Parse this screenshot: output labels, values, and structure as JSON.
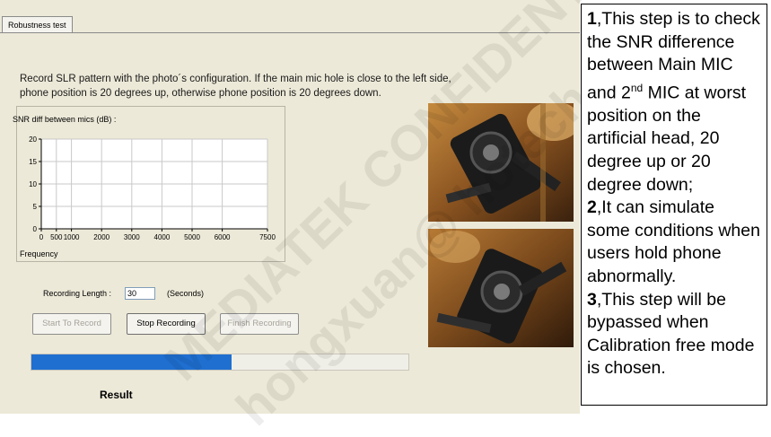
{
  "tab": {
    "label": "Robustness test"
  },
  "instructions": {
    "line1": "Record SLR pattern with the photo´s configuration. If the main mic hole is close to the left side,",
    "line2": "phone position is 20 degrees up, otherwise phone position is 20 degrees down."
  },
  "chart": {
    "group_title": "SNR diff between mics (dB) :",
    "xlabel": "Frequency"
  },
  "chart_data": {
    "type": "line",
    "title": "SNR diff between mics (dB) :",
    "xlabel": "Frequency",
    "ylabel": "",
    "xticks": [
      0,
      500,
      1000,
      2000,
      3000,
      4000,
      5000,
      6000,
      7500
    ],
    "xtick_labels": [
      "0",
      "500",
      "1000",
      "2000",
      "3000",
      "4000",
      "5000",
      "6000",
      "7500"
    ],
    "yticks": [
      0,
      5,
      10,
      15,
      20
    ],
    "ytick_labels": [
      "0",
      "5",
      "10",
      "15",
      "20"
    ],
    "xlim": [
      0,
      7500
    ],
    "ylim": [
      0,
      20
    ],
    "grid": true,
    "series": []
  },
  "recording": {
    "label": "Recording Length :",
    "value": "30",
    "unit": "(Seconds)"
  },
  "buttons": {
    "start": "Start To Record",
    "stop": "Stop Recording",
    "finish": "Finish Recording"
  },
  "progress": {
    "fraction": 0.53
  },
  "result": {
    "label": "Result"
  },
  "watermark": {
    "line1": "MEDIATEK CONFIDENTIAL",
    "line2": "hongxuan@ hotech.cn"
  },
  "note": {
    "p1_num": "1",
    "p1_a": ",This step is to check the SNR difference between Main MIC and 2",
    "p1_sup": "nd",
    "p1_b": " MIC at worst position on the artificial head, 20 degree up or 20 degree down;",
    "p2_num": "2",
    "p2_text": ",It can simulate some conditions when users hold phone abnormally.",
    "p3_num": "3",
    "p3_text": ",This step will be bypassed when Calibration free mode is chosen."
  },
  "colors": {
    "app_bg": "#ece9d8",
    "progress_fill": "#1f6fd0"
  }
}
